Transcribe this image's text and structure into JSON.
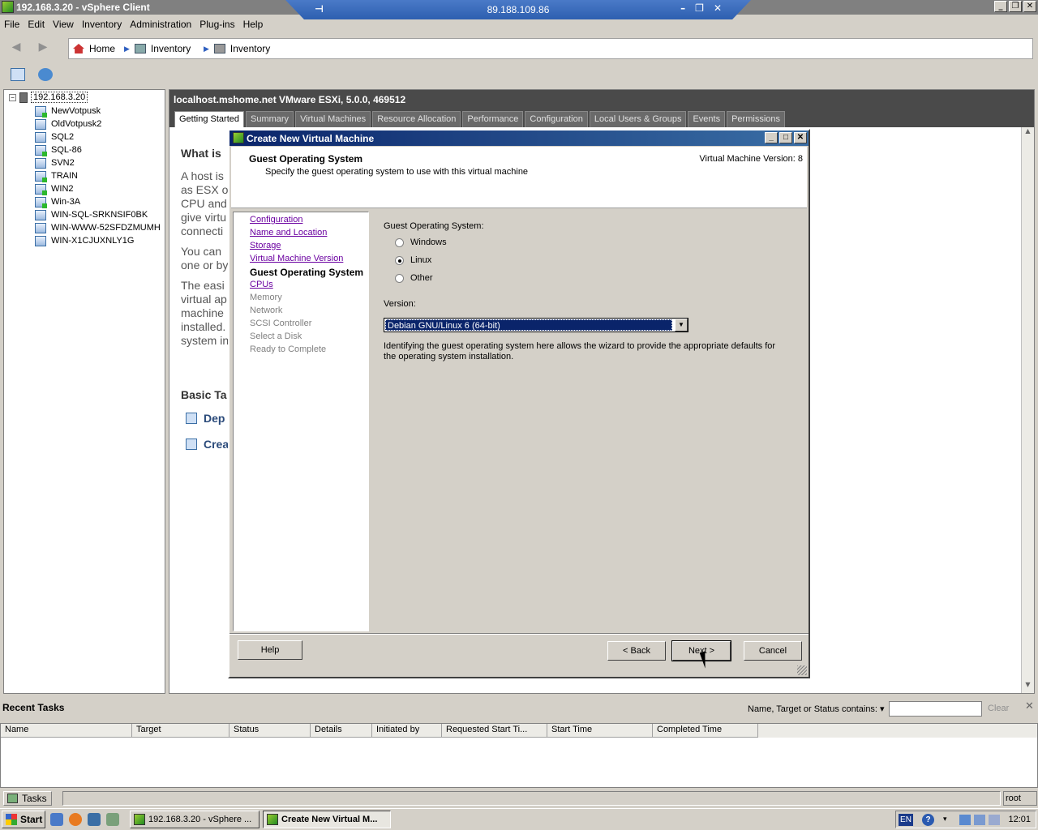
{
  "window": {
    "title": "192.168.3.20 - vSphere Client"
  },
  "rdp": {
    "address": "89.188.109.86"
  },
  "menu": [
    "File",
    "Edit",
    "View",
    "Inventory",
    "Administration",
    "Plug-ins",
    "Help"
  ],
  "breadcrumb": {
    "home": "Home",
    "inventory1": "Inventory",
    "inventory2": "Inventory"
  },
  "tree": {
    "root": "192.168.3.20",
    "vms": [
      {
        "name": "NewVotpusk",
        "on": true
      },
      {
        "name": "OldVotpusk2",
        "on": false
      },
      {
        "name": "SQL2",
        "on": false
      },
      {
        "name": "SQL-86",
        "on": true
      },
      {
        "name": "SVN2",
        "on": false
      },
      {
        "name": "TRAIN",
        "on": true
      },
      {
        "name": "WIN2",
        "on": true
      },
      {
        "name": "Win-3A",
        "on": true
      },
      {
        "name": "WIN-SQL-SRKNSIF0BK",
        "on": false
      },
      {
        "name": "WIN-WWW-52SFDZMUMH",
        "on": false
      },
      {
        "name": "WIN-X1CJUXNLY1G",
        "on": false
      }
    ]
  },
  "main": {
    "host_title": "localhost.mshome.net VMware ESXi, 5.0.0, 469512",
    "tabs": [
      "Getting Started",
      "Summary",
      "Virtual Machines",
      "Resource Allocation",
      "Performance",
      "Configuration",
      "Local Users & Groups",
      "Events",
      "Permissions"
    ],
    "active_tab": "Getting Started",
    "gs_heading": "What is",
    "gs_lines1": [
      "A host is",
      "as ESX o",
      "CPU and",
      "give virtu",
      "connecti"
    ],
    "gs_lines2": [
      "You can",
      "one or by"
    ],
    "gs_lines3": [
      "The easi",
      "virtual ap",
      "machine",
      "installed.",
      "system in"
    ],
    "basic_tasks": "Basic Ta",
    "task1": "Dep",
    "task2": "Crea"
  },
  "dialog": {
    "title": "Create New Virtual Machine",
    "heading": "Guest Operating System",
    "subheading": "Specify the guest operating system to use with this virtual machine",
    "vm_version": "Virtual Machine Version: 8",
    "steps": [
      {
        "label": "Configuration",
        "state": "link"
      },
      {
        "label": "Name and Location",
        "state": "link"
      },
      {
        "label": "Storage",
        "state": "link"
      },
      {
        "label": "Virtual Machine Version",
        "state": "link"
      },
      {
        "label": "Guest Operating System",
        "state": "current"
      },
      {
        "label": "CPUs",
        "state": "link"
      },
      {
        "label": "Memory",
        "state": "disabled"
      },
      {
        "label": "Network",
        "state": "disabled"
      },
      {
        "label": "SCSI Controller",
        "state": "disabled"
      },
      {
        "label": "Select a Disk",
        "state": "disabled"
      },
      {
        "label": "Ready to Complete",
        "state": "disabled"
      }
    ],
    "guest_os_label": "Guest Operating System:",
    "os_options": [
      "Windows",
      "Linux",
      "Other"
    ],
    "os_selected": "Linux",
    "version_label": "Version:",
    "version_value": "Debian GNU/Linux 6 (64-bit)",
    "note": "Identifying the guest operating system here allows the wizard to provide the appropriate defaults for the operating system installation.",
    "help_btn": "Help",
    "back_btn": "< Back",
    "next_btn": "Next >",
    "cancel_btn": "Cancel"
  },
  "recent_tasks": {
    "label": "Recent Tasks",
    "filter_label": "Name, Target or Status contains: ▾",
    "clear": "Clear",
    "columns": [
      "Name",
      "Target",
      "Status",
      "Details",
      "Initiated by",
      "Requested Start Ti...",
      "Start Time",
      "Completed Time"
    ]
  },
  "statusbar": {
    "tasks": "Tasks",
    "user": "root"
  },
  "taskbar": {
    "start": "Start",
    "items": [
      "192.168.3.20 - vSphere ...",
      "Create New Virtual M..."
    ],
    "lang": "EN",
    "time": "12:01"
  }
}
